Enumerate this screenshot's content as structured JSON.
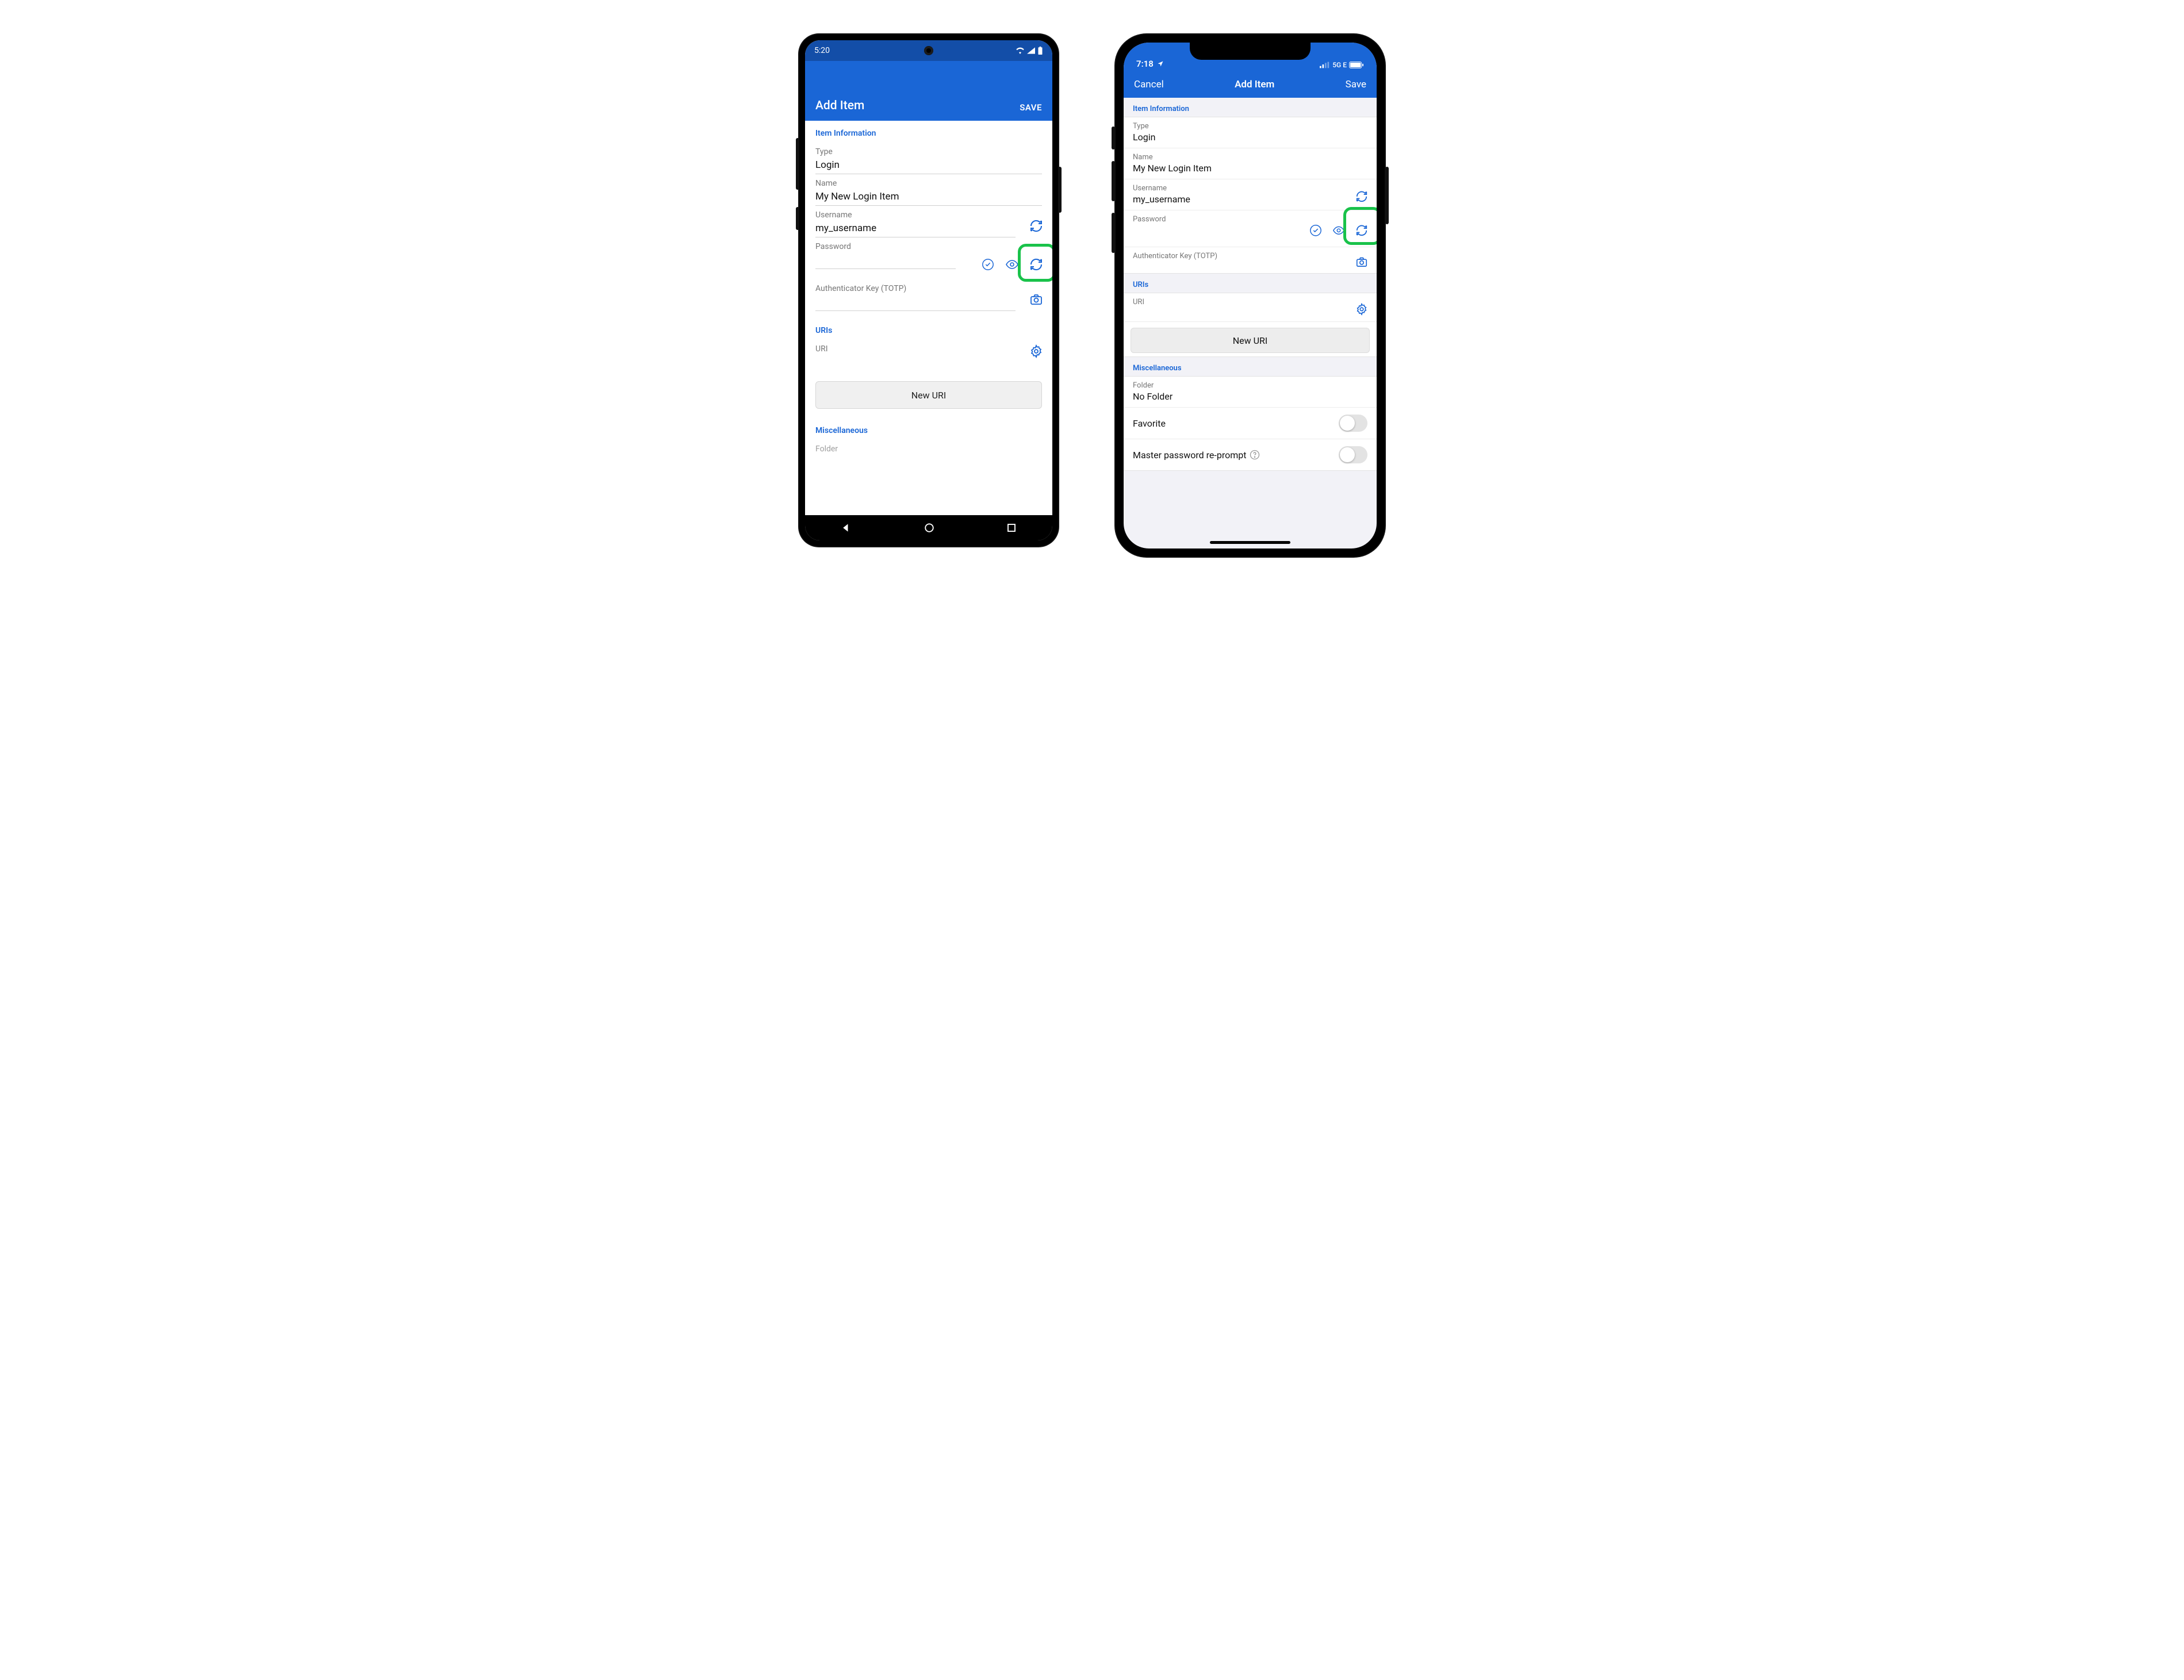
{
  "colors": {
    "brand": "#1a66d6",
    "brand_dark": "#134ea8",
    "highlight": "#19c24a"
  },
  "android": {
    "statusbar": {
      "time": "5:20"
    },
    "header": {
      "title": "Add Item",
      "save": "SAVE"
    },
    "sections": {
      "item_info": "Item Information",
      "uris": "URIs",
      "misc": "Miscellaneous"
    },
    "fields": {
      "type": {
        "label": "Type",
        "value": "Login"
      },
      "name": {
        "label": "Name",
        "value": "My New Login Item"
      },
      "username": {
        "label": "Username",
        "value": "my_username"
      },
      "password": {
        "label": "Password",
        "value": ""
      },
      "totp": {
        "label": "Authenticator Key (TOTP)",
        "value": ""
      },
      "uri": {
        "label": "URI",
        "value": ""
      },
      "folder": {
        "label": "Folder",
        "value": ""
      }
    },
    "buttons": {
      "new_uri": "New URI"
    }
  },
  "ios": {
    "statusbar": {
      "time": "7:18",
      "network": "5G E"
    },
    "header": {
      "cancel": "Cancel",
      "title": "Add Item",
      "save": "Save"
    },
    "sections": {
      "item_info": "Item Information",
      "uris": "URIs",
      "misc": "Miscellaneous"
    },
    "fields": {
      "type": {
        "label": "Type",
        "value": "Login"
      },
      "name": {
        "label": "Name",
        "value": "My New Login Item"
      },
      "username": {
        "label": "Username",
        "value": "my_username"
      },
      "password": {
        "label": "Password",
        "value": ""
      },
      "totp": {
        "label": "Authenticator Key (TOTP)",
        "value": ""
      },
      "uri": {
        "label": "URI",
        "value": ""
      },
      "folder": {
        "label": "Folder",
        "value": "No Folder"
      },
      "favorite": {
        "label": "Favorite",
        "value": false
      },
      "reprompt": {
        "label": "Master password re-prompt",
        "value": false
      }
    },
    "buttons": {
      "new_uri": "New URI"
    }
  }
}
